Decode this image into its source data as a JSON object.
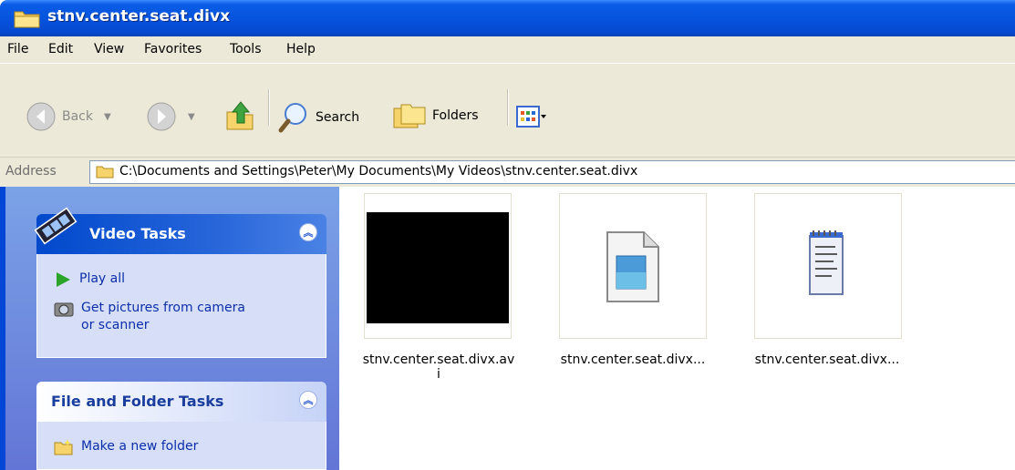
{
  "window": {
    "title": "stnv.center.seat.divx"
  },
  "menu": [
    "File",
    "Edit",
    "View",
    "Favorites",
    "Tools",
    "Help"
  ],
  "toolbar": {
    "back_label": "Back",
    "search_label": "Search",
    "folders_label": "Folders"
  },
  "address": {
    "label": "Address",
    "path": "C:\\Documents and Settings\\Peter\\My Documents\\My Videos\\stnv.center.seat.divx"
  },
  "left_pane": {
    "video_tasks": {
      "title": "Video Tasks",
      "items": [
        "Play all",
        "Get pictures from camera",
        "or scanner"
      ]
    },
    "file_folder_tasks": {
      "title": "File and Folder Tasks",
      "items": [
        "Make a new folder"
      ]
    }
  },
  "files": [
    {
      "name_line1": "stnv.center.seat.divx.av",
      "name_line2": "i",
      "icon": "video-thumbnail"
    },
    {
      "name_line1": "stnv.center.seat.divx...",
      "name_line2": "",
      "icon": "media-file-icon"
    },
    {
      "name_line1": "stnv.center.seat.divx...",
      "name_line2": "",
      "icon": "notepad-icon"
    }
  ]
}
